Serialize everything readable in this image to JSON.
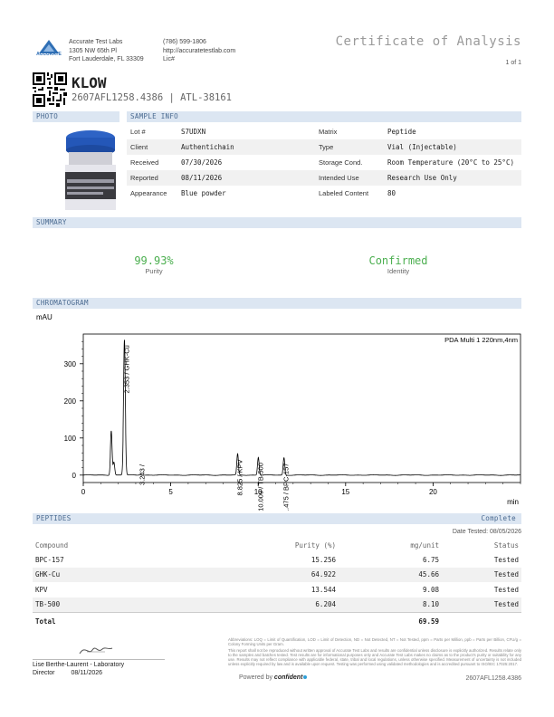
{
  "lab": {
    "name": "Accurate Test Labs",
    "address1": "1305 NW 65th Pl",
    "address2": "Fort Lauderdale, FL 33309",
    "phone": "(786) 599-1806",
    "website": "http://accuratetestlab.com",
    "lic": "Lic#",
    "logo_text": "ACCURATE"
  },
  "doc": {
    "title": "Certificate of Analysis",
    "page": "1 of 1",
    "product": "KLOW",
    "ids": "2607AFL1258.4386 | ATL-38161"
  },
  "sections": {
    "photo": "PHOTO",
    "sample_info": "SAMPLE INFO",
    "summary": "SUMMARY",
    "chromatogram": "CHROMATOGRAM",
    "peptides": "PEPTIDES",
    "peptides_status": "Complete"
  },
  "sample_info": {
    "lot_label": "Lot #",
    "lot": "S7UDXN",
    "client_label": "Client",
    "client": "Authentichain",
    "received_label": "Received",
    "received": "07/30/2026",
    "reported_label": "Reported",
    "reported": "08/11/2026",
    "appearance_label": "Appearance",
    "appearance": "Blue powder",
    "matrix_label": "Matrix",
    "matrix": "Peptide",
    "type_label": "Type",
    "type": "Vial (Injectable)",
    "storage_label": "Storage Cond.",
    "storage": "Room Temperature (20°C to 25°C)",
    "intended_label": "Intended Use",
    "intended": "Research Use Only",
    "labeled_label": "Labeled Content",
    "labeled": "80"
  },
  "summary": {
    "purity_value": "99.93%",
    "purity_label": "Purity",
    "identity_value": "Confirmed",
    "identity_label": "Identity",
    "purity_color": "#4caf50",
    "identity_color": "#4caf50"
  },
  "chart_data": {
    "type": "line",
    "title": "PDA Multi 1 220nm,4nm",
    "ylabel": "mAU",
    "xlabel": "min",
    "xlim": [
      0,
      25
    ],
    "ylim": [
      -20,
      380
    ],
    "xticks": [
      "0",
      "5",
      "10",
      "15",
      "20"
    ],
    "yticks": [
      "0",
      "100",
      "200",
      "300"
    ],
    "peaks": [
      {
        "x": 1.6,
        "y": 120,
        "label": ""
      },
      {
        "x": 1.75,
        "y": 35,
        "label": ""
      },
      {
        "x": 2.353,
        "y": 365,
        "label": "2.353 / GHK-Cu"
      },
      {
        "x": 3.243,
        "y": 2,
        "label": "3.243 /"
      },
      {
        "x": 8.825,
        "y": 57,
        "label": "8.825 / KPV"
      },
      {
        "x": 10.009,
        "y": 48,
        "label": "10.009 / TB-500"
      },
      {
        "x": 11.475,
        "y": 47,
        "label": "11.475 / BPC-157"
      }
    ],
    "line_color": "#000000"
  },
  "peptides": {
    "date_tested": "Date Tested: 08/05/2026",
    "headers": [
      "Compound",
      "Purity (%)",
      "mg/unit",
      "Status"
    ],
    "rows": [
      {
        "compound": "BPC-157",
        "purity": "15.256",
        "mg": "6.75",
        "status": "Tested"
      },
      {
        "compound": "GHK-Cu",
        "purity": "64.922",
        "mg": "45.66",
        "status": "Tested"
      },
      {
        "compound": "KPV",
        "purity": "13.544",
        "mg": "9.08",
        "status": "Tested"
      },
      {
        "compound": "TB-500",
        "purity": "6.204",
        "mg": "8.10",
        "status": "Tested"
      }
    ],
    "total_label": "Total",
    "total_mg": "69.59"
  },
  "footer": {
    "signer": "Lise Berthe-Laurent - Laboratory",
    "signer_title": "Director",
    "sign_date": "08/11/2026",
    "abbrev": "Abbreviations: LOQ = Limit of Quantification, LOD = Limit of Detection, ND = Not Detected, NT = Not Tested, ppm = Parts per Million, ppb = Parts per Billion, CFU/g = Colony Forming Units per Gram.",
    "disclaimer": "This report shall not be reproduced without written approval of Accurate Test Labs and results are confidential unless disclosure is explicitly authorized. Results relate only to the samples and batches tested. Test results are for informational purposes only and Accurate Test Labs makes no claims as to the product's purity or suitability for any use. Results may not reflect compliance with applicable federal, state, tribal and local regulations, unless otherwise specified. Measurement of uncertainty is not included unless explicitly required by law and is available upon request. Testing was performed using validated methodologies and is accredited pursuant to ISO/IEC 17025:2017.",
    "powered": "Powered by",
    "brand": "confident",
    "report_id": "2607AFL1258.4386"
  }
}
